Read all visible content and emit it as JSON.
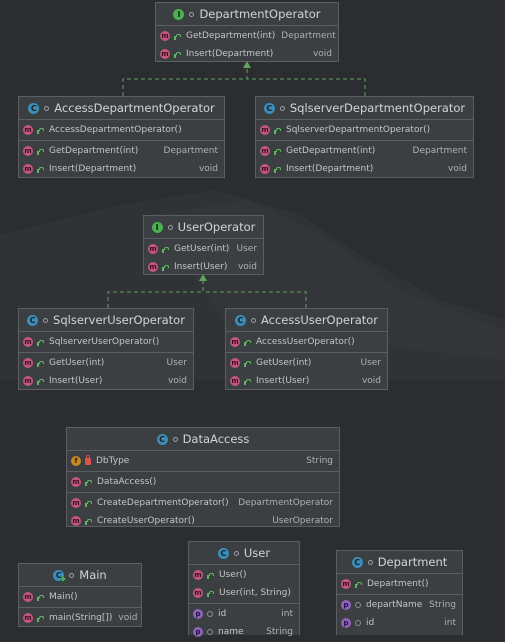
{
  "colors": {
    "background": "#2b2d30",
    "node_fill": "#3c3f41",
    "node_border": "#5b5f63",
    "interface_badge": "#4caf50",
    "class_badge": "#3b8eba",
    "method_badge": "#c2577c",
    "field_badge": "#c78b26",
    "property_badge": "#8c63b8",
    "connector": "#5fa35f"
  },
  "nodes": {
    "department_operator": {
      "kind": "interface",
      "badge": "I",
      "title": "DepartmentOperator",
      "methods": [
        {
          "badge": "m",
          "name": "GetDepartment(int)",
          "type": "Department"
        },
        {
          "badge": "m",
          "name": "Insert(Department)",
          "type": "void"
        }
      ]
    },
    "access_department_operator": {
      "kind": "class",
      "badge": "C",
      "title": "AccessDepartmentOperator",
      "constructors": [
        {
          "badge": "m",
          "name": "AccessDepartmentOperator()",
          "type": ""
        }
      ],
      "methods": [
        {
          "badge": "m",
          "name": "GetDepartment(int)",
          "type": "Department"
        },
        {
          "badge": "m",
          "name": "Insert(Department)",
          "type": "void"
        }
      ]
    },
    "sqlserver_department_operator": {
      "kind": "class",
      "badge": "C",
      "title": "SqlserverDepartmentOperator",
      "constructors": [
        {
          "badge": "m",
          "name": "SqlserverDepartmentOperator()",
          "type": ""
        }
      ],
      "methods": [
        {
          "badge": "m",
          "name": "GetDepartment(int)",
          "type": "Department"
        },
        {
          "badge": "m",
          "name": "Insert(Department)",
          "type": "void"
        }
      ]
    },
    "user_operator": {
      "kind": "interface",
      "badge": "I",
      "title": "UserOperator",
      "methods": [
        {
          "badge": "m",
          "name": "GetUser(int)",
          "type": "User"
        },
        {
          "badge": "m",
          "name": "Insert(User)",
          "type": "void"
        }
      ]
    },
    "sqlserver_user_operator": {
      "kind": "class",
      "badge": "C",
      "title": "SqlserverUserOperator",
      "constructors": [
        {
          "badge": "m",
          "name": "SqlserverUserOperator()",
          "type": ""
        }
      ],
      "methods": [
        {
          "badge": "m",
          "name": "GetUser(int)",
          "type": "User"
        },
        {
          "badge": "m",
          "name": "Insert(User)",
          "type": "void"
        }
      ]
    },
    "access_user_operator": {
      "kind": "class",
      "badge": "C",
      "title": "AccessUserOperator",
      "constructors": [
        {
          "badge": "m",
          "name": "AccessUserOperator()",
          "type": ""
        }
      ],
      "methods": [
        {
          "badge": "m",
          "name": "GetUser(int)",
          "type": "User"
        },
        {
          "badge": "m",
          "name": "Insert(User)",
          "type": "void"
        }
      ]
    },
    "data_access": {
      "kind": "class",
      "badge": "C",
      "title": "DataAccess",
      "fields": [
        {
          "badge": "f",
          "name": "DbType",
          "type": "String"
        }
      ],
      "constructors": [
        {
          "badge": "m",
          "name": "DataAccess()",
          "type": ""
        }
      ],
      "methods": [
        {
          "badge": "m",
          "name": "CreateDepartmentOperator()",
          "type": "DepartmentOperator"
        },
        {
          "badge": "m",
          "name": "CreateUserOperator()",
          "type": "UserOperator"
        }
      ]
    },
    "main": {
      "kind": "class",
      "badge": "C",
      "title": "Main",
      "constructors": [
        {
          "badge": "m",
          "name": "Main()",
          "type": ""
        }
      ],
      "methods": [
        {
          "badge": "m",
          "name": "main(String[])",
          "type": "void"
        }
      ]
    },
    "user": {
      "kind": "class",
      "badge": "C",
      "title": "User",
      "constructors": [
        {
          "badge": "m",
          "name": "User()",
          "type": ""
        },
        {
          "badge": "m",
          "name": "User(int, String)",
          "type": ""
        }
      ],
      "properties": [
        {
          "badge": "p",
          "name": "id",
          "type": "int"
        },
        {
          "badge": "p",
          "name": "name",
          "type": "String"
        }
      ]
    },
    "department": {
      "kind": "class",
      "badge": "C",
      "title": "Department",
      "constructors": [
        {
          "badge": "m",
          "name": "Department()",
          "type": ""
        }
      ],
      "properties": [
        {
          "badge": "p",
          "name": "departName",
          "type": "String"
        },
        {
          "badge": "p",
          "name": "id",
          "type": "int"
        }
      ]
    }
  }
}
